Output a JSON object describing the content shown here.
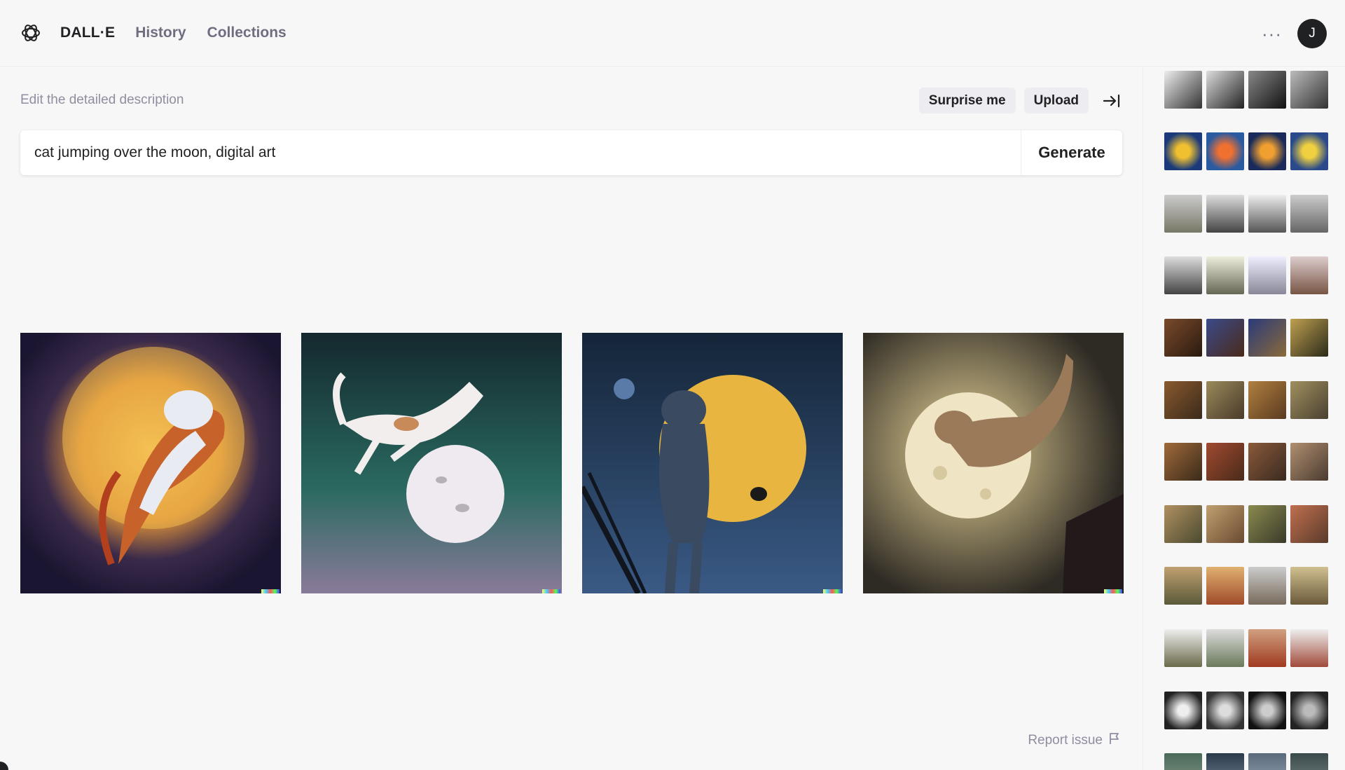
{
  "header": {
    "logo_icon": "openai-logo-icon",
    "brand": "DALL·E",
    "nav": [
      "History",
      "Collections"
    ],
    "more_icon": "···",
    "avatar_initial": "J"
  },
  "editor": {
    "label": "Edit the detailed description",
    "surprise_label": "Surprise me",
    "upload_label": "Upload",
    "collapse_icon": "collapse-right-icon",
    "prompt_value": "cat jumping over the moon, digital art",
    "generate_label": "Generate"
  },
  "results": [
    {
      "alt": "result-image-1",
      "bg": "#2a1f3d",
      "moon": "#f2b94a"
    },
    {
      "alt": "result-image-2",
      "bg": "#1f3a3f",
      "moon": "#eeeaf0"
    },
    {
      "alt": "result-image-3",
      "bg": "#243a55",
      "moon": "#e8b640"
    },
    {
      "alt": "result-image-4",
      "bg": "#4b4535",
      "moon": "#f0e6c8"
    }
  ],
  "report": {
    "label": "Report issue",
    "icon": "flag-icon"
  },
  "history_rows": [
    [
      "#3a3a3a",
      "#555555",
      "#2e2e2e",
      "#4a4a4a"
    ],
    [
      "#1f4f8f",
      "#2c5aa0",
      "#1b3e78",
      "#2a5592"
    ],
    [
      "#8b8b80",
      "#6f6f6a",
      "#9a9a94",
      "#7d7d78"
    ],
    [
      "#7a7a74",
      "#8c8378",
      "#9a9a98",
      "#6e5a50"
    ],
    [
      "#5a3a25",
      "#3a4a7a",
      "#2a3a6a",
      "#5a5030"
    ],
    [
      "#6a4a2a",
      "#7a6a4a",
      "#8a6a3a",
      "#7a6a4a"
    ],
    [
      "#7a4a2a",
      "#8a3a2a",
      "#6a4a30",
      "#8a6a4a"
    ],
    [
      "#8a7050",
      "#a08060",
      "#6a6a40",
      "#a06040"
    ],
    [
      "#8a7a50",
      "#b08050",
      "#8a7a6a",
      "#9a8a60"
    ],
    [
      "#7a7a6a",
      "#8a8a7a",
      "#a04030",
      "#9a7a6a"
    ],
    [
      "#333333",
      "#444444",
      "#2a2a2a",
      "#3a3a3a"
    ],
    [
      "#4a6a5a",
      "#2a3a4a",
      "#5a6a7a",
      "#3a4a4a"
    ]
  ]
}
